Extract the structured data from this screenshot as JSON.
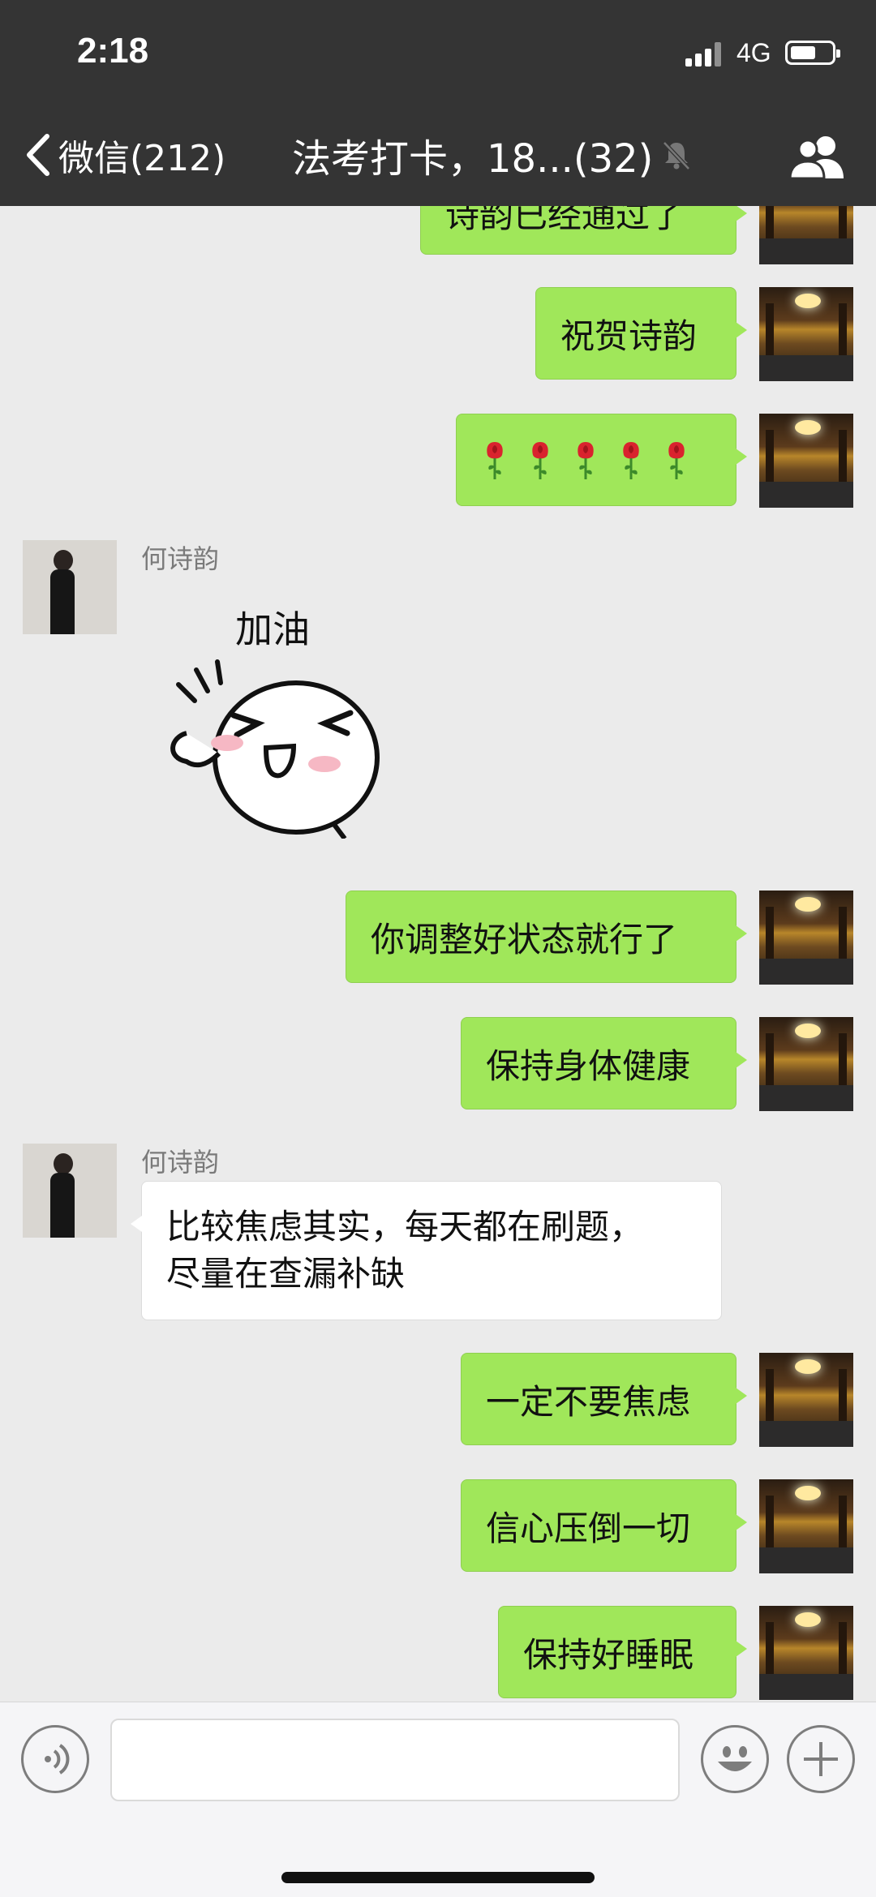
{
  "status": {
    "time": "2:18",
    "network": "4G"
  },
  "nav": {
    "back_label": "微信(212)",
    "title": "法考打卡，18...(32)"
  },
  "messages": {
    "m1": "诗韵已经通过了",
    "m2": "祝贺诗韵",
    "m3_roses": 5,
    "sender_1": "何诗韵",
    "sticker_text": "加油",
    "m5": "你调整好状态就行了",
    "m6": "保持身体健康",
    "sender_2": "何诗韵",
    "m7_line1": "比较焦虑其实，每天都在刷题，",
    "m7_line2": "尽量在查漏补缺",
    "m8": "一定不要焦虑",
    "m9": "信心压倒一切",
    "m10": "保持好睡眠"
  },
  "input": {
    "placeholder": ""
  },
  "colors": {
    "bar": "#343434",
    "my_bubble": "#a0e75a",
    "chat_bg": "#ebebeb"
  }
}
